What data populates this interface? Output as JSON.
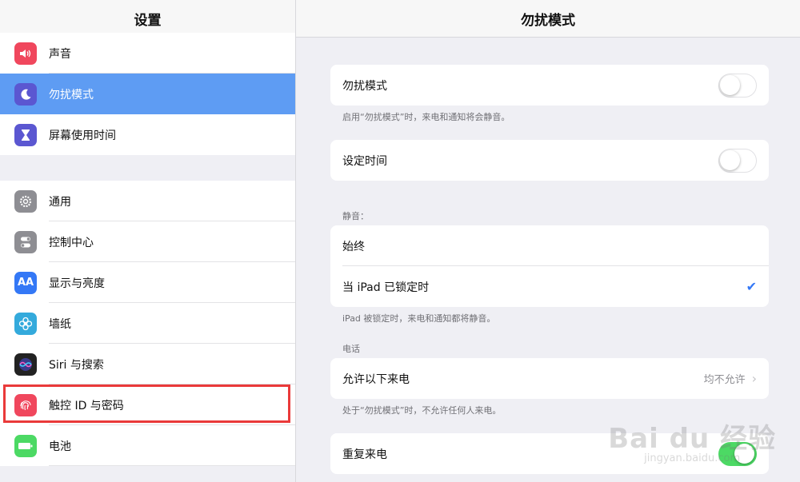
{
  "sidebar": {
    "title": "设置",
    "group1": [
      {
        "label": "声音",
        "icon": "speaker-icon",
        "color": "#f0475d"
      },
      {
        "label": "勿扰模式",
        "icon": "moon-icon",
        "color": "#5b57d1"
      },
      {
        "label": "屏幕使用时间",
        "icon": "hourglass-icon",
        "color": "#5b57d1"
      }
    ],
    "group2": [
      {
        "label": "通用",
        "icon": "gear-icon",
        "color": "#8e8e93"
      },
      {
        "label": "控制中心",
        "icon": "toggles-icon",
        "color": "#8e8e93"
      },
      {
        "label": "显示与亮度",
        "icon": "text-size-icon",
        "color": "#3478f6"
      },
      {
        "label": "墙纸",
        "icon": "flower-icon",
        "color": "#34aadc"
      },
      {
        "label": "Siri 与搜索",
        "icon": "siri-icon",
        "color": "#222222"
      },
      {
        "label": "触控 ID 与密码",
        "icon": "fingerprint-icon",
        "color": "#f0475d"
      },
      {
        "label": "电池",
        "icon": "battery-icon",
        "color": "#4cd964"
      }
    ],
    "selected": "勿扰模式"
  },
  "main": {
    "title": "勿扰模式",
    "dnd_label": "勿扰模式",
    "dnd_on": false,
    "dnd_footnote": "启用“勿扰模式”时，来电和通知将会静音。",
    "scheduled_label": "设定时间",
    "scheduled_on": false,
    "silence_header": "静音：",
    "silence_always": "始终",
    "silence_locked": "当 iPad 已锁定时",
    "silence_footnote": "iPad 被锁定时，来电和通知都将静音。",
    "phone_header": "电话",
    "allow_calls_label": "允许以下来电",
    "allow_calls_value": "均不允许",
    "allow_calls_footnote": "处于“勿扰模式”时，不允许任何人来电。",
    "repeated_calls_label": "重复来电",
    "repeated_calls_on": true
  },
  "watermark": {
    "main": "Bai du 经验",
    "sub": "jingyan.baidu.com"
  }
}
